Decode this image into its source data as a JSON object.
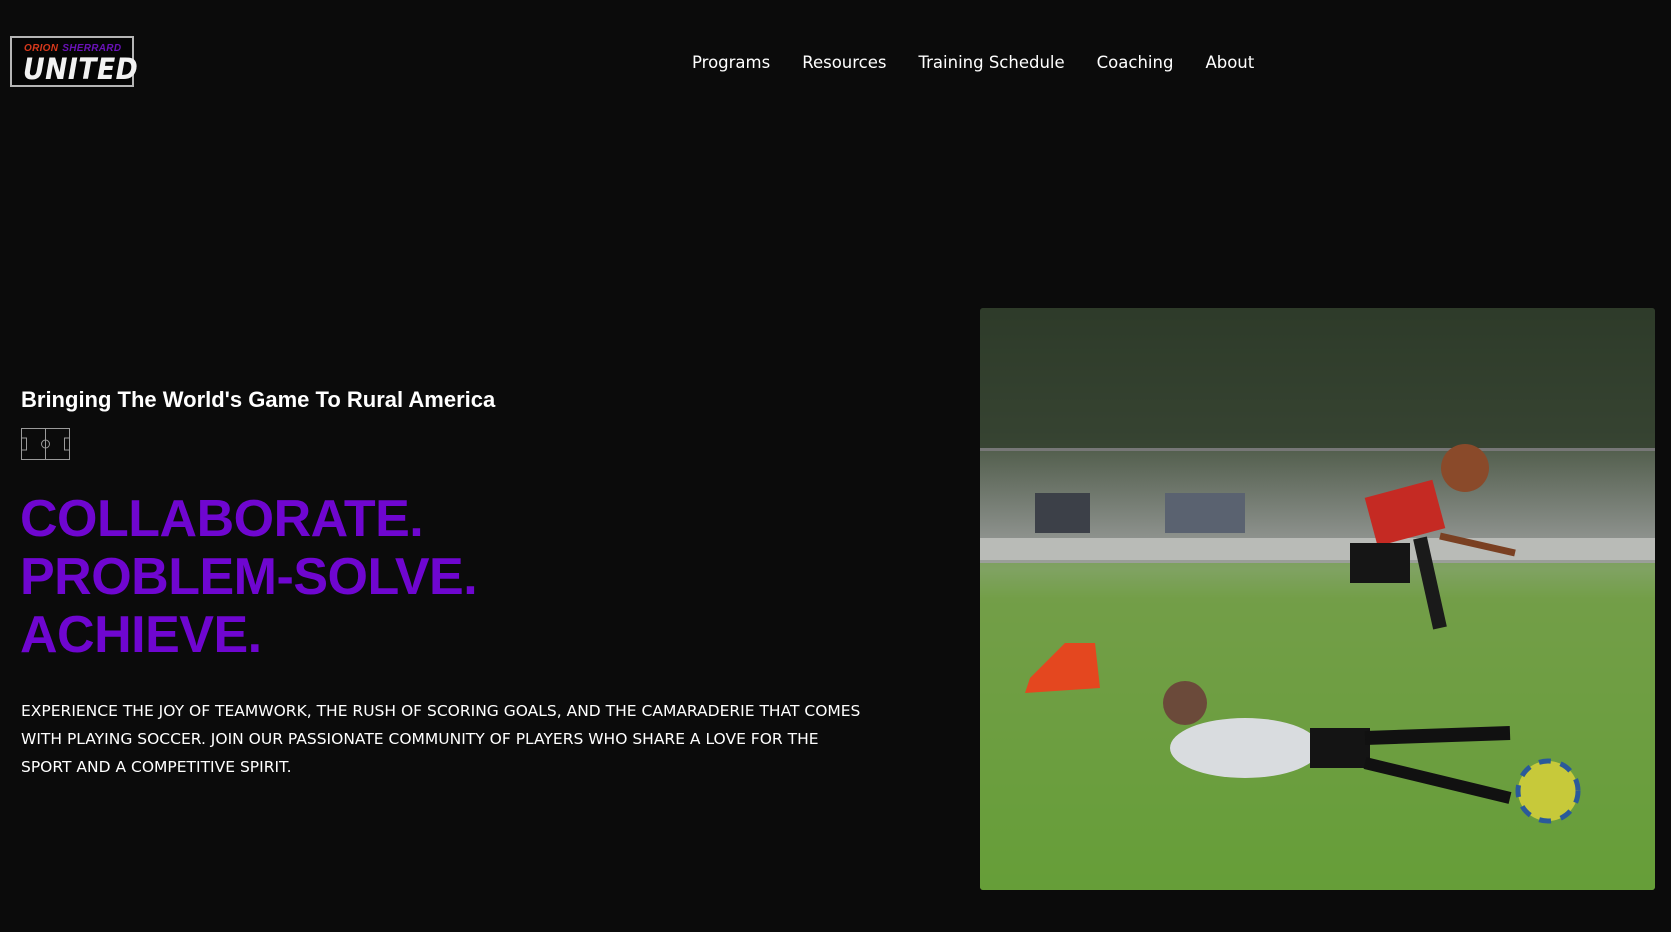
{
  "logo": {
    "top_left": "ORION",
    "top_right": "SHERRARD",
    "main": "UNITED"
  },
  "nav": {
    "items": [
      "Programs",
      "Resources",
      "Training Schedule",
      "Coaching",
      "About"
    ]
  },
  "hero": {
    "subheading": "Bringing The World's Game To Rural America",
    "headline": [
      "COLLABORATE.",
      "PROBLEM-SOLVE.",
      "ACHIEVE."
    ],
    "paragraph": "EXPERIENCE THE JOY OF TEAMWORK, THE RUSH OF SCORING GOALS, AND THE CAMARADERIE THAT COMES WITH PLAYING SOCCER. JOIN OUR PASSIONATE COMMUNITY OF PLAYERS WHO SHARE A LOVE FOR THE SPORT AND A COMPETITIVE SPIRIT."
  },
  "colors": {
    "accent": "#6f06d0",
    "background": "#0b0b0b"
  }
}
